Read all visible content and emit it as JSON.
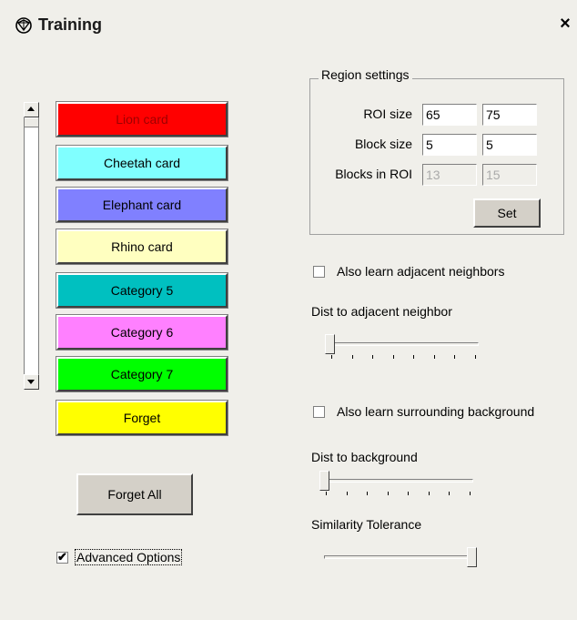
{
  "window": {
    "title": "Training",
    "close_label": "×",
    "icon": "app-icon"
  },
  "categories": [
    {
      "label": "Lion card",
      "color": "#ff0000",
      "text_color": "#a00000"
    },
    {
      "label": "Cheetah card",
      "color": "#80ffff"
    },
    {
      "label": "Elephant card",
      "color": "#8080ff"
    },
    {
      "label": "Rhino card",
      "color": "#ffffc0"
    },
    {
      "label": "Category 5",
      "color": "#00c0c0"
    },
    {
      "label": "Category 6",
      "color": "#ff80ff"
    },
    {
      "label": "Category 7",
      "color": "#00ff00"
    },
    {
      "label": "Forget",
      "color": "#ffff00"
    }
  ],
  "forget_all_label": "Forget All",
  "advanced_options": {
    "label": "Advanced Options",
    "checked": true
  },
  "region_settings": {
    "title": "Region settings",
    "roi_size_label": "ROI size",
    "roi_size": [
      "65",
      "75"
    ],
    "block_size_label": "Block size",
    "block_size": [
      "5",
      "5"
    ],
    "blocks_in_roi_label": "Blocks in ROI",
    "blocks_in_roi": [
      "13",
      "15"
    ],
    "set_label": "Set"
  },
  "adjacent": {
    "checkbox_label": "Also learn adjacent neighbors",
    "checked": false,
    "slider_label": "Dist to adjacent neighbor",
    "value": 0
  },
  "background": {
    "checkbox_label": "Also learn surrounding background",
    "checked": false,
    "slider_label": "Dist to background",
    "value": 0
  },
  "similarity": {
    "slider_label": "Similarity Tolerance",
    "value": 1
  }
}
